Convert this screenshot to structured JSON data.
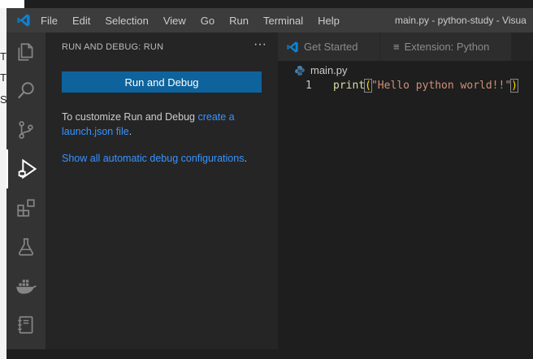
{
  "background": {
    "letters": [
      "T",
      "T",
      "S"
    ]
  },
  "window": {
    "title": "main.py - python-study - Visua",
    "menu": [
      "File",
      "Edit",
      "Selection",
      "View",
      "Go",
      "Run",
      "Terminal",
      "Help"
    ]
  },
  "activity_bar": {
    "items": [
      "explorer-icon",
      "search-icon",
      "source-control-icon",
      "run-debug-icon",
      "extensions-icon",
      "testing-icon",
      "docker-icon",
      "notebook-icon"
    ],
    "active": "run-debug-icon"
  },
  "sidebar": {
    "title": "RUN AND DEBUG: RUN",
    "more": "···",
    "run_button": "Run and Debug",
    "customize_text": "To customize Run and Debug ",
    "customize_link": "create a launch.json file",
    "customize_end": ".",
    "show_link": "Show all automatic debug configurations",
    "show_end": "."
  },
  "editor": {
    "tabs": [
      "Get Started",
      "Extension: Python"
    ],
    "breadcrumb_file": "main.py",
    "lines": [
      {
        "number": "1",
        "fn": "print",
        "open": "(",
        "string": "\"Hello python world!!\"",
        "close": ")"
      }
    ]
  },
  "colors": {
    "accent": "#0e639c",
    "link": "#3794ff",
    "activity_bg": "#333333",
    "sidebar_bg": "#252526"
  }
}
